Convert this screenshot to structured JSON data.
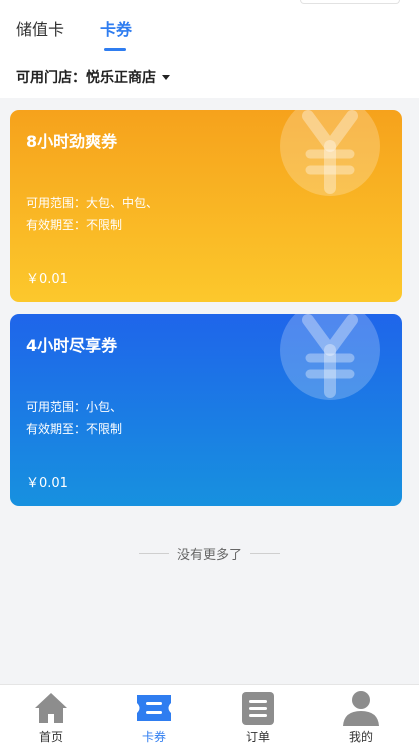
{
  "tabs": [
    {
      "label": "储值卡",
      "active": false
    },
    {
      "label": "卡券",
      "active": true
    }
  ],
  "store": {
    "label": "可用门店：悦乐正商店"
  },
  "coupons": [
    {
      "name": "8小时劲爽券",
      "scope": "可用范围：大包、中包、",
      "validity": "有效期至：不限制",
      "price": "￥0.01",
      "color_top": "#f6a21c",
      "color_bottom": "#fcc82c"
    },
    {
      "name": "4小时尽享券",
      "scope": "可用范围：小包、",
      "validity": "有效期至：不限制",
      "price": "￥0.01",
      "color_top": "#1f65ea",
      "color_bottom": "#1791df"
    }
  ],
  "footer_note": "没有更多了",
  "nav": [
    {
      "label": "首页",
      "icon": "home-icon",
      "active": false
    },
    {
      "label": "卡券",
      "icon": "ticket-icon",
      "active": true
    },
    {
      "label": "订单",
      "icon": "order-list-icon",
      "active": false
    },
    {
      "label": "我的",
      "icon": "user-icon",
      "active": false
    }
  ],
  "colors": {
    "accent": "#2f7df0",
    "background": "#f3f4f6",
    "nav_icon_inactive": "#8d8d8d"
  }
}
